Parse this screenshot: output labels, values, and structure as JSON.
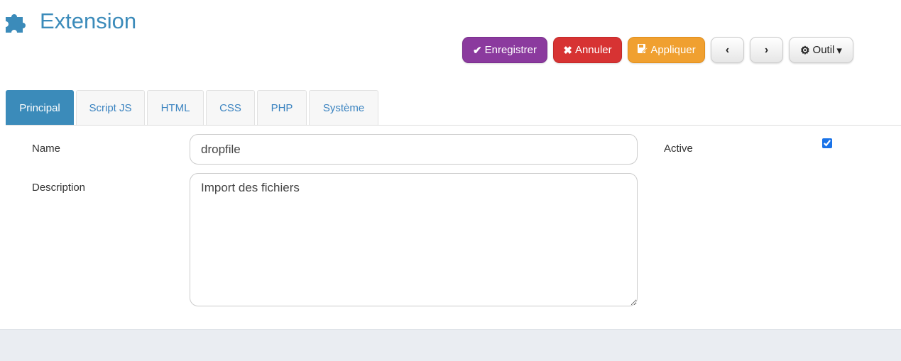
{
  "header": {
    "title": "Extension",
    "icon": "puzzle-icon",
    "accent_color": "#3b8bba"
  },
  "toolbar": {
    "save_label": "Enregistrer",
    "cancel_label": "Annuler",
    "apply_label": "Appliquer",
    "tool_label": "Outil",
    "save_icon": "✔",
    "cancel_icon": "✖",
    "apply_icon": "save-edit-icon",
    "prev_icon": "‹",
    "next_icon": "›",
    "caret_icon": "▾",
    "gear_icon": "⚙",
    "colors": {
      "save": "#8b3a9e",
      "cancel": "#d73333",
      "apply": "#f0a030"
    }
  },
  "tabs": [
    {
      "label": "Principal",
      "active": true
    },
    {
      "label": "Script JS",
      "active": false
    },
    {
      "label": "HTML",
      "active": false
    },
    {
      "label": "CSS",
      "active": false
    },
    {
      "label": "PHP",
      "active": false
    },
    {
      "label": "Système",
      "active": false
    }
  ],
  "form": {
    "name_label": "Name",
    "name_value": "dropfile",
    "description_label": "Description",
    "description_value": "Import des fichiers",
    "active_label": "Active",
    "active_checked": true
  }
}
